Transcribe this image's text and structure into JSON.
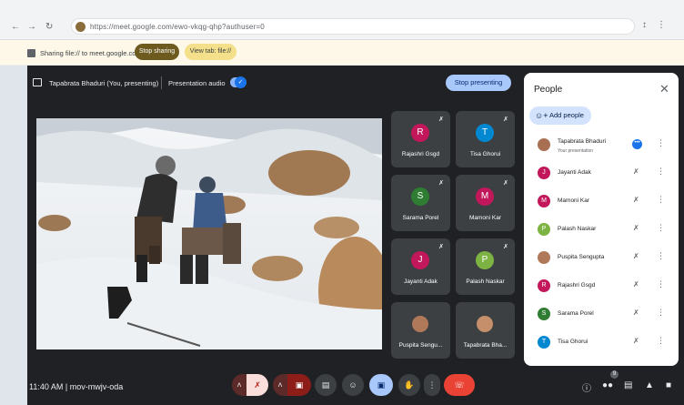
{
  "browser": {
    "url": "https://meet.google.com/ewo-vkqg-qhp?authuser=0"
  },
  "share_bar": {
    "text": "Sharing file:// to meet.google.com",
    "stop_label": "Stop sharing",
    "view_label": "View tab: file://"
  },
  "presentation": {
    "presenter_text": "Tapabrata Bhaduri (You, presenting)",
    "audio_label": "Presentation audio",
    "audio_on": true,
    "stop_label": "Stop presenting"
  },
  "tiles": [
    {
      "name": "Rajashri Gsgd",
      "initial": "R",
      "color": "#c2185b"
    },
    {
      "name": "Tisa Ghorui",
      "initial": "T",
      "color": "#0288d1"
    },
    {
      "name": "Sarama Porel",
      "initial": "S",
      "color": "#2e7d32"
    },
    {
      "name": "Mamoni Kar",
      "initial": "M",
      "color": "#c2185b"
    },
    {
      "name": "Jayanti Adak",
      "initial": "J",
      "color": "#c2185b"
    },
    {
      "name": "Palash Naskar",
      "initial": "P",
      "color": "#7cb342"
    },
    {
      "name": "Puspita Sengu...",
      "initial": "",
      "color": "#b07a5a"
    },
    {
      "name": "Tapabrata Bha...",
      "initial": "",
      "color": "#c48f6a"
    }
  ],
  "people_panel": {
    "title": "People",
    "add_label": "Add people",
    "members": [
      {
        "name": "Tapabrata Bhaduri",
        "sub": "Your presentation",
        "initial": "",
        "color": "#a86f52"
      },
      {
        "name": "Jayanti Adak",
        "sub": "",
        "initial": "J",
        "color": "#c2185b"
      },
      {
        "name": "Mamoni Kar",
        "sub": "",
        "initial": "M",
        "color": "#c2185b"
      },
      {
        "name": "Palash Naskar",
        "sub": "",
        "initial": "P",
        "color": "#7cb342"
      },
      {
        "name": "Puspita Sengupta",
        "sub": "",
        "initial": "",
        "color": "#b07a5a"
      },
      {
        "name": "Rajashri Gsgd",
        "sub": "",
        "initial": "R",
        "color": "#c2185b"
      },
      {
        "name": "Sarama Porel",
        "sub": "",
        "initial": "S",
        "color": "#2e7d32"
      },
      {
        "name": "Tisa Ghorui",
        "sub": "",
        "initial": "T",
        "color": "#0288d1"
      }
    ]
  },
  "bottom": {
    "time_code": "11:40 AM | mov-mwjv-oda",
    "people_count": "9"
  }
}
